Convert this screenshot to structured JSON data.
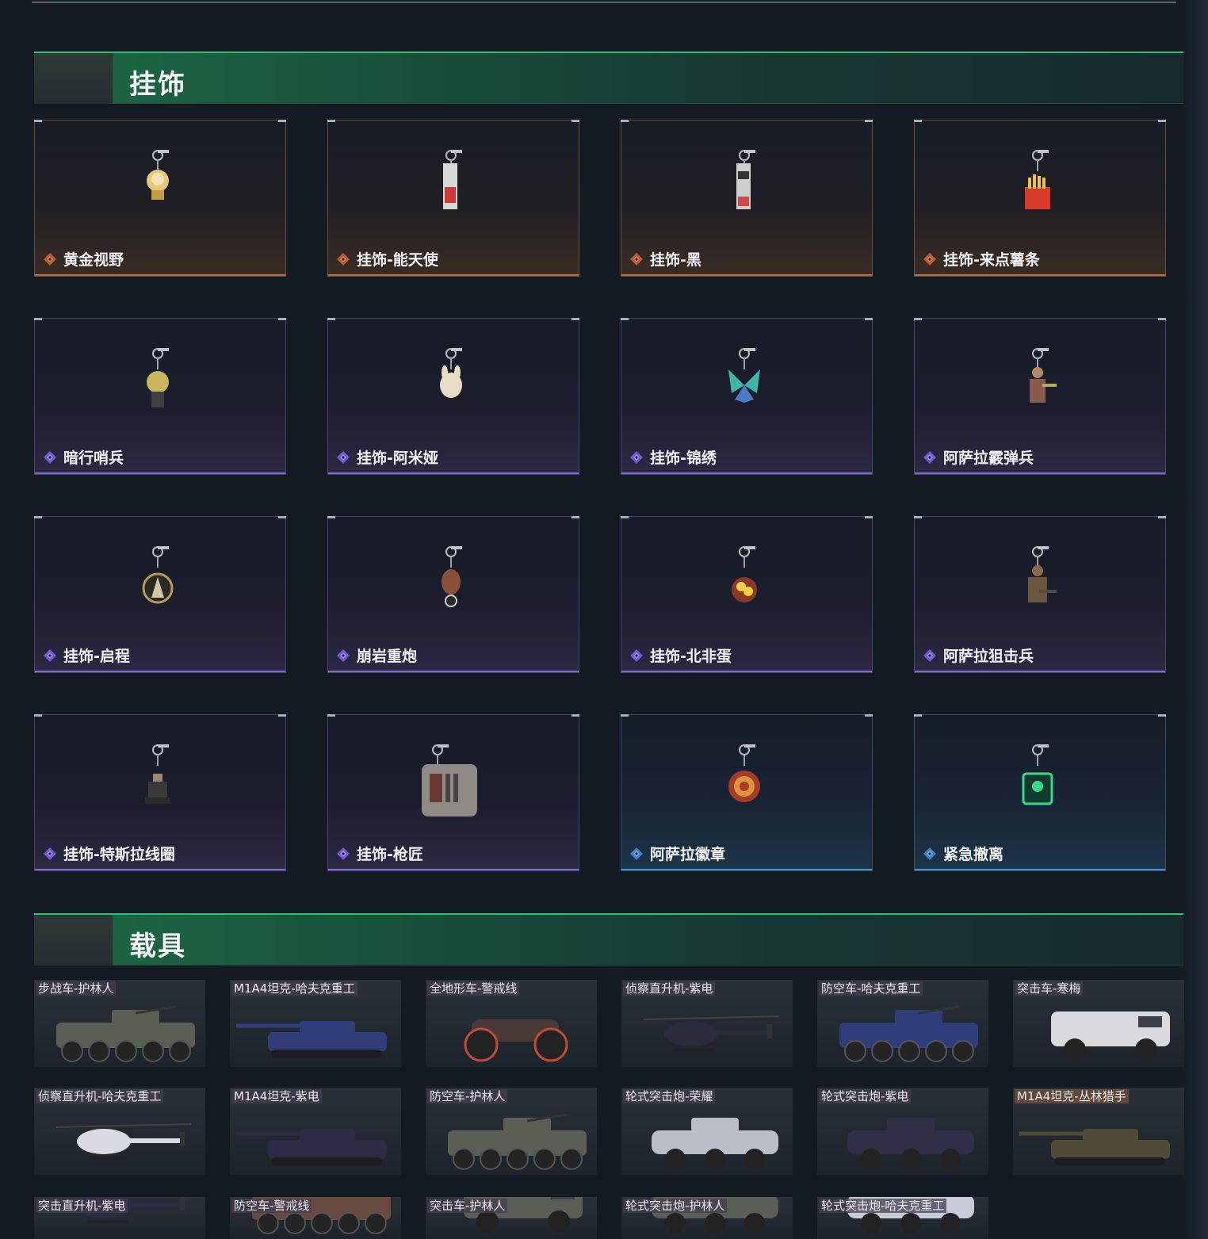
{
  "sections": {
    "charms_title": "挂饰",
    "vehicles_title": "载具"
  },
  "charms": [
    {
      "label": "黄金视野",
      "rarity": "orange"
    },
    {
      "label": "挂饰-能天使",
      "rarity": "orange"
    },
    {
      "label": "挂饰-黑",
      "rarity": "orange"
    },
    {
      "label": "挂饰-来点薯条",
      "rarity": "orange"
    },
    {
      "label": "暗行哨兵",
      "rarity": "purple"
    },
    {
      "label": "挂饰-阿米娅",
      "rarity": "purple"
    },
    {
      "label": "挂饰-锦绣",
      "rarity": "purple"
    },
    {
      "label": "阿萨拉霰弹兵",
      "rarity": "purple"
    },
    {
      "label": "挂饰-启程",
      "rarity": "purple"
    },
    {
      "label": "崩岩重炮",
      "rarity": "purple"
    },
    {
      "label": "挂饰-北非蛋",
      "rarity": "purple"
    },
    {
      "label": "阿萨拉狙击兵",
      "rarity": "purple"
    },
    {
      "label": "挂饰-特斯拉线圈",
      "rarity": "purple"
    },
    {
      "label": "挂饰-枪匠",
      "rarity": "purple"
    },
    {
      "label": "阿萨拉徽章",
      "rarity": "blue"
    },
    {
      "label": "紧急撤离",
      "rarity": "blue"
    }
  ],
  "vehicles": [
    {
      "label": "步战车-护林人",
      "kind": "apc",
      "color": "#5b5e55"
    },
    {
      "label": "M1A4坦克-哈夫克重工",
      "kind": "tank",
      "color": "#2f3d7a"
    },
    {
      "label": "全地形车-警戒线",
      "kind": "atv",
      "color": "#4a3a36"
    },
    {
      "label": "侦察直升机-紫电",
      "kind": "heli",
      "color": "#2a2a3a"
    },
    {
      "label": "防空车-哈夫克重工",
      "kind": "apc",
      "color": "#2f3d7a"
    },
    {
      "label": "突击车-寒梅",
      "kind": "truck",
      "color": "#d9dadc"
    },
    {
      "label": "侦察直升机-哈夫克重工",
      "kind": "heli",
      "color": "#d8dbe6"
    },
    {
      "label": "M1A4坦克-紫电",
      "kind": "tank",
      "color": "#2e2b44"
    },
    {
      "label": "防空车-护林人",
      "kind": "apc",
      "color": "#5b5e55"
    },
    {
      "label": "轮式突击炮-荣耀",
      "kind": "wheeled",
      "color": "#b9bec6"
    },
    {
      "label": "轮式突击炮-紫电",
      "kind": "wheeled",
      "color": "#2f3048"
    },
    {
      "label": "M1A4坦克-丛林猎手",
      "kind": "tank",
      "color": "#4f4b38",
      "gold": true
    },
    {
      "label": "突击直升机-紫电",
      "kind": "heli",
      "color": "#2e2b44"
    },
    {
      "label": "防空车-警戒线",
      "kind": "apc",
      "color": "#6a4a40"
    },
    {
      "label": "突击车-护林人",
      "kind": "truck",
      "color": "#5b5e55"
    },
    {
      "label": "轮式突击炮-护林人",
      "kind": "wheeled",
      "color": "#5b5e55"
    },
    {
      "label": "轮式突击炮-哈夫克重工",
      "kind": "wheeled",
      "color": "#c7ccd8"
    }
  ]
}
